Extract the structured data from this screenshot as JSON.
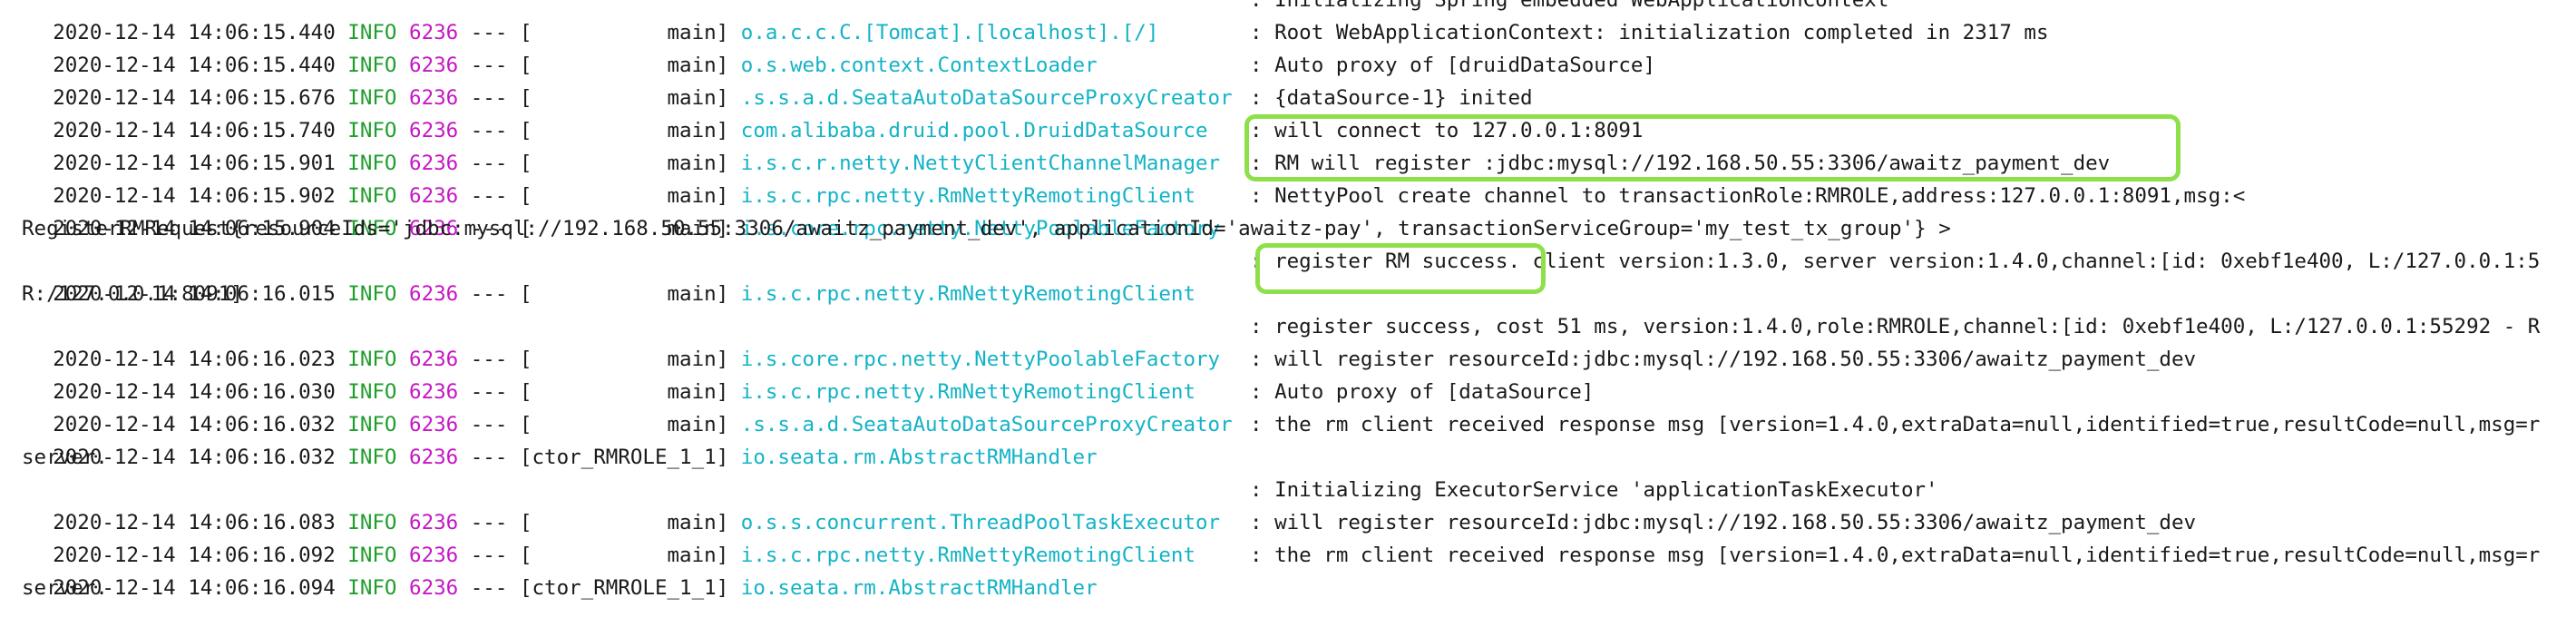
{
  "console": {
    "lines": [
      {
        "kind": "entry",
        "ts": "2020-12-14 14:06:15.440",
        "level": "INFO",
        "pid": "6236",
        "dashes": "---",
        "thread": "[           main]",
        "logger": "o.a.c.c.C.[Tomcat].[localhost].[/]",
        "msg": ": Initializing Spring embedded WebApplicationContext"
      },
      {
        "kind": "entry",
        "ts": "2020-12-14 14:06:15.440",
        "level": "INFO",
        "pid": "6236",
        "dashes": "---",
        "thread": "[           main]",
        "logger": "o.s.web.context.ContextLoader",
        "msg": ": Root WebApplicationContext: initialization completed in 2317 ms"
      },
      {
        "kind": "entry",
        "ts": "2020-12-14 14:06:15.676",
        "level": "INFO",
        "pid": "6236",
        "dashes": "---",
        "thread": "[           main]",
        "logger": ".s.s.a.d.SeataAutoDataSourceProxyCreator",
        "msg": ": Auto proxy of [druidDataSource]"
      },
      {
        "kind": "entry",
        "ts": "2020-12-14 14:06:15.740",
        "level": "INFO",
        "pid": "6236",
        "dashes": "---",
        "thread": "[           main]",
        "logger": "com.alibaba.druid.pool.DruidDataSource",
        "msg": ": {dataSource-1} inited"
      },
      {
        "kind": "entry",
        "ts": "2020-12-14 14:06:15.901",
        "level": "INFO",
        "pid": "6236",
        "dashes": "---",
        "thread": "[           main]",
        "logger": "i.s.c.r.netty.NettyClientChannelManager",
        "msg": ": will connect to 127.0.0.1:8091"
      },
      {
        "kind": "entry",
        "ts": "2020-12-14 14:06:15.902",
        "level": "INFO",
        "pid": "6236",
        "dashes": "---",
        "thread": "[           main]",
        "logger": "i.s.c.rpc.netty.RmNettyRemotingClient",
        "msg": ": RM will register :jdbc:mysql://192.168.50.55:3306/awaitz_payment_dev"
      },
      {
        "kind": "entry",
        "ts": "2020-12-14 14:06:15.904",
        "level": "INFO",
        "pid": "6236",
        "dashes": "---",
        "thread": "[           main]",
        "logger": "i.s.core.rpc.netty.NettyPoolableFactory",
        "msg": ": NettyPool create channel to transactionRole:RMROLE,address:127.0.0.1:8091,msg:<"
      },
      {
        "kind": "cont",
        "text": "RegisterRMRequest{resourceIds='jdbc:mysql://192.168.50.55:3306/awaitz_payment_dev', applicationId='awaitz-pay', transactionServiceGroup='my_test_tx_group'} >"
      },
      {
        "kind": "entry",
        "ts": "2020-12-14 14:06:16.015",
        "level": "INFO",
        "pid": "6236",
        "dashes": "---",
        "thread": "[           main]",
        "logger": "i.s.c.rpc.netty.RmNettyRemotingClient",
        "msg": ": register RM success. client version:1.3.0, server version:1.4.0,channel:[id: 0xebf1e400, L:/127.0.0.1:5"
      },
      {
        "kind": "cont",
        "text": "R:/127.0.0.1:8091]"
      },
      {
        "kind": "entry",
        "ts": "2020-12-14 14:06:16.023",
        "level": "INFO",
        "pid": "6236",
        "dashes": "---",
        "thread": "[           main]",
        "logger": "i.s.core.rpc.netty.NettyPoolableFactory",
        "msg": ": register success, cost 51 ms, version:1.4.0,role:RMROLE,channel:[id: 0xebf1e400, L:/127.0.0.1:55292 - R"
      },
      {
        "kind": "entry",
        "ts": "2020-12-14 14:06:16.030",
        "level": "INFO",
        "pid": "6236",
        "dashes": "---",
        "thread": "[           main]",
        "logger": "i.s.c.rpc.netty.RmNettyRemotingClient",
        "msg": ": will register resourceId:jdbc:mysql://192.168.50.55:3306/awaitz_payment_dev"
      },
      {
        "kind": "entry",
        "ts": "2020-12-14 14:06:16.032",
        "level": "INFO",
        "pid": "6236",
        "dashes": "---",
        "thread": "[           main]",
        "logger": ".s.s.a.d.SeataAutoDataSourceProxyCreator",
        "msg": ": Auto proxy of [dataSource]"
      },
      {
        "kind": "entry",
        "ts": "2020-12-14 14:06:16.032",
        "level": "INFO",
        "pid": "6236",
        "dashes": "---",
        "thread": "[ctor_RMROLE_1_1]",
        "logger": "io.seata.rm.AbstractRMHandler",
        "msg": ": the rm client received response msg [version=1.4.0,extraData=null,identified=true,resultCode=null,msg=r"
      },
      {
        "kind": "cont",
        "text": "server."
      },
      {
        "kind": "entry",
        "ts": "2020-12-14 14:06:16.083",
        "level": "INFO",
        "pid": "6236",
        "dashes": "---",
        "thread": "[           main]",
        "logger": "o.s.s.concurrent.ThreadPoolTaskExecutor",
        "msg": ": Initializing ExecutorService 'applicationTaskExecutor'"
      },
      {
        "kind": "entry",
        "ts": "2020-12-14 14:06:16.092",
        "level": "INFO",
        "pid": "6236",
        "dashes": "---",
        "thread": "[           main]",
        "logger": "i.s.c.rpc.netty.RmNettyRemotingClient",
        "msg": ": will register resourceId:jdbc:mysql://192.168.50.55:3306/awaitz_payment_dev"
      },
      {
        "kind": "entry",
        "ts": "2020-12-14 14:06:16.094",
        "level": "INFO",
        "pid": "6236",
        "dashes": "---",
        "thread": "[ctor_RMROLE_1_1]",
        "logger": "io.seata.rm.AbstractRMHandler",
        "msg": ": the rm client received response msg [version=1.4.0,extraData=null,identified=true,resultCode=null,msg=r"
      },
      {
        "kind": "cont",
        "text": "server."
      }
    ],
    "colors": {
      "level": "#1f9e2c",
      "pid": "#c418c4",
      "logger": "#14b3c6",
      "text": "#1a1a1a",
      "highlight": "#8ee04a"
    }
  }
}
